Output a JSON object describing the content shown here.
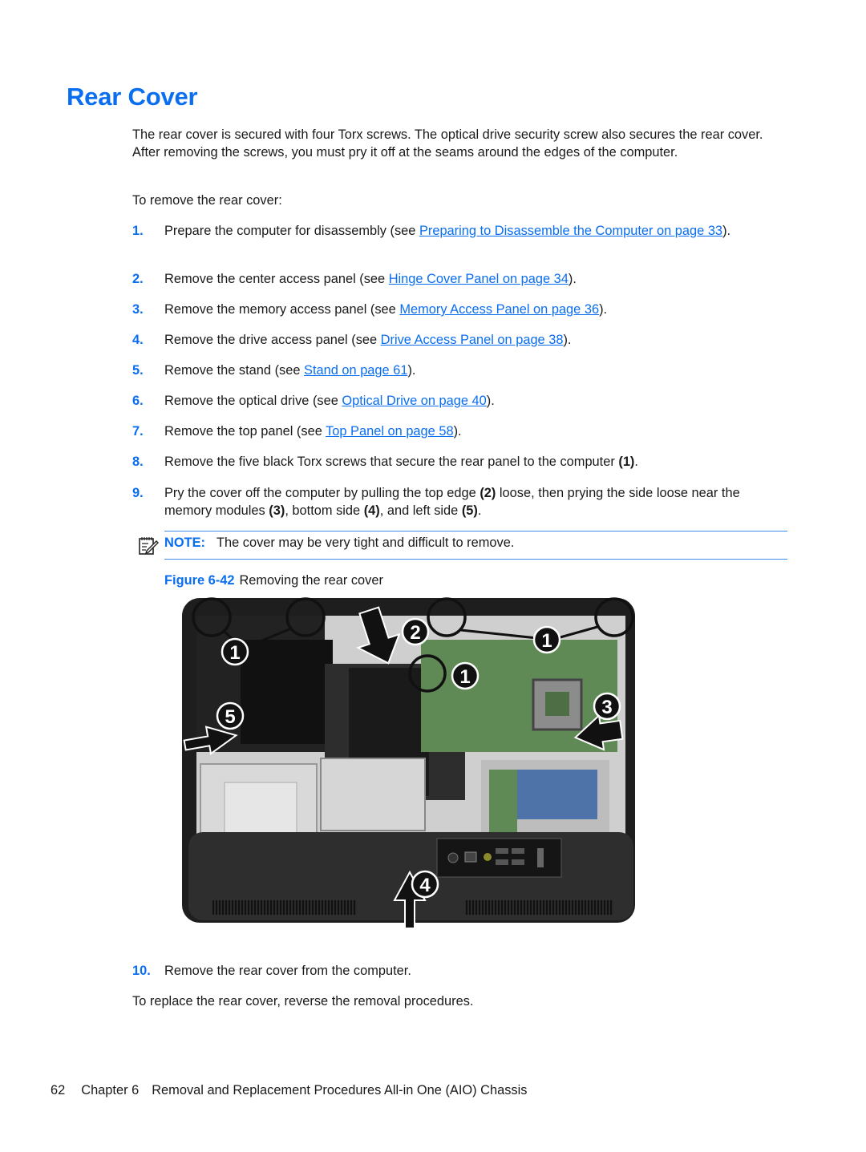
{
  "page": {
    "title": "Rear Cover",
    "intro": "The rear cover is secured with four Torx screws. The optical drive security screw also secures the rear cover. After removing the screws, you must pry it off at the seams around the edges of the computer.",
    "lead_in": "To remove the rear cover:",
    "steps": [
      {
        "num": "1.",
        "before": "Prepare the computer for disassembly (see ",
        "link": "Preparing to Disassemble the Computer on page 33",
        "after": ")."
      },
      {
        "num": "2.",
        "before": "Remove the center access panel (see ",
        "link": "Hinge Cover Panel on page 34",
        "after": ")."
      },
      {
        "num": "3.",
        "before": "Remove the memory access panel (see ",
        "link": "Memory Access Panel on page 36",
        "after": ")."
      },
      {
        "num": "4.",
        "before": "Remove the drive access panel (see ",
        "link": "Drive Access Panel on page 38",
        "after": ")."
      },
      {
        "num": "5.",
        "before": "Remove the stand (see ",
        "link": "Stand on page 61",
        "after": ")."
      },
      {
        "num": "6.",
        "before": "Remove the optical drive (see ",
        "link": "Optical Drive on page 40",
        "after": ")."
      },
      {
        "num": "7.",
        "before": "Remove the top panel (see ",
        "link": "Top Panel on page 58",
        "after": ")."
      },
      {
        "num": "8.",
        "text": "Remove the five black Torx screws that secure the rear panel to the computer ",
        "callout": "(1)",
        "after": "."
      },
      {
        "num": "9.",
        "t1": "Pry the cover off the computer by pulling the top edge ",
        "c1": "(2)",
        "t2": " loose, then prying the side loose near the memory modules ",
        "c2": "(3)",
        "t3": ", bottom side ",
        "c3": "(4)",
        "t4": ", and left side ",
        "c4": "(5)",
        "t5": "."
      },
      {
        "num": "10.",
        "text": "Remove the rear cover from the computer."
      }
    ],
    "note": {
      "icon": "note-pencil-icon",
      "label": "NOTE:",
      "text": "The cover may be very tight and difficult to remove."
    },
    "figure": {
      "label": "Figure 6-42",
      "caption": "Removing the rear cover",
      "callouts": [
        "1",
        "1",
        "1",
        "2",
        "3",
        "4",
        "5"
      ]
    },
    "closing": "To replace the rear cover, reverse the removal procedures.",
    "footer": {
      "page_number": "62",
      "chapter": "Chapter 6",
      "chapter_title": "Removal and Replacement Procedures All-in One (AIO) Chassis"
    }
  },
  "colors": {
    "accent": "#0a6ef0",
    "rule": "#3d8fe8",
    "text": "#1a1a1a"
  }
}
